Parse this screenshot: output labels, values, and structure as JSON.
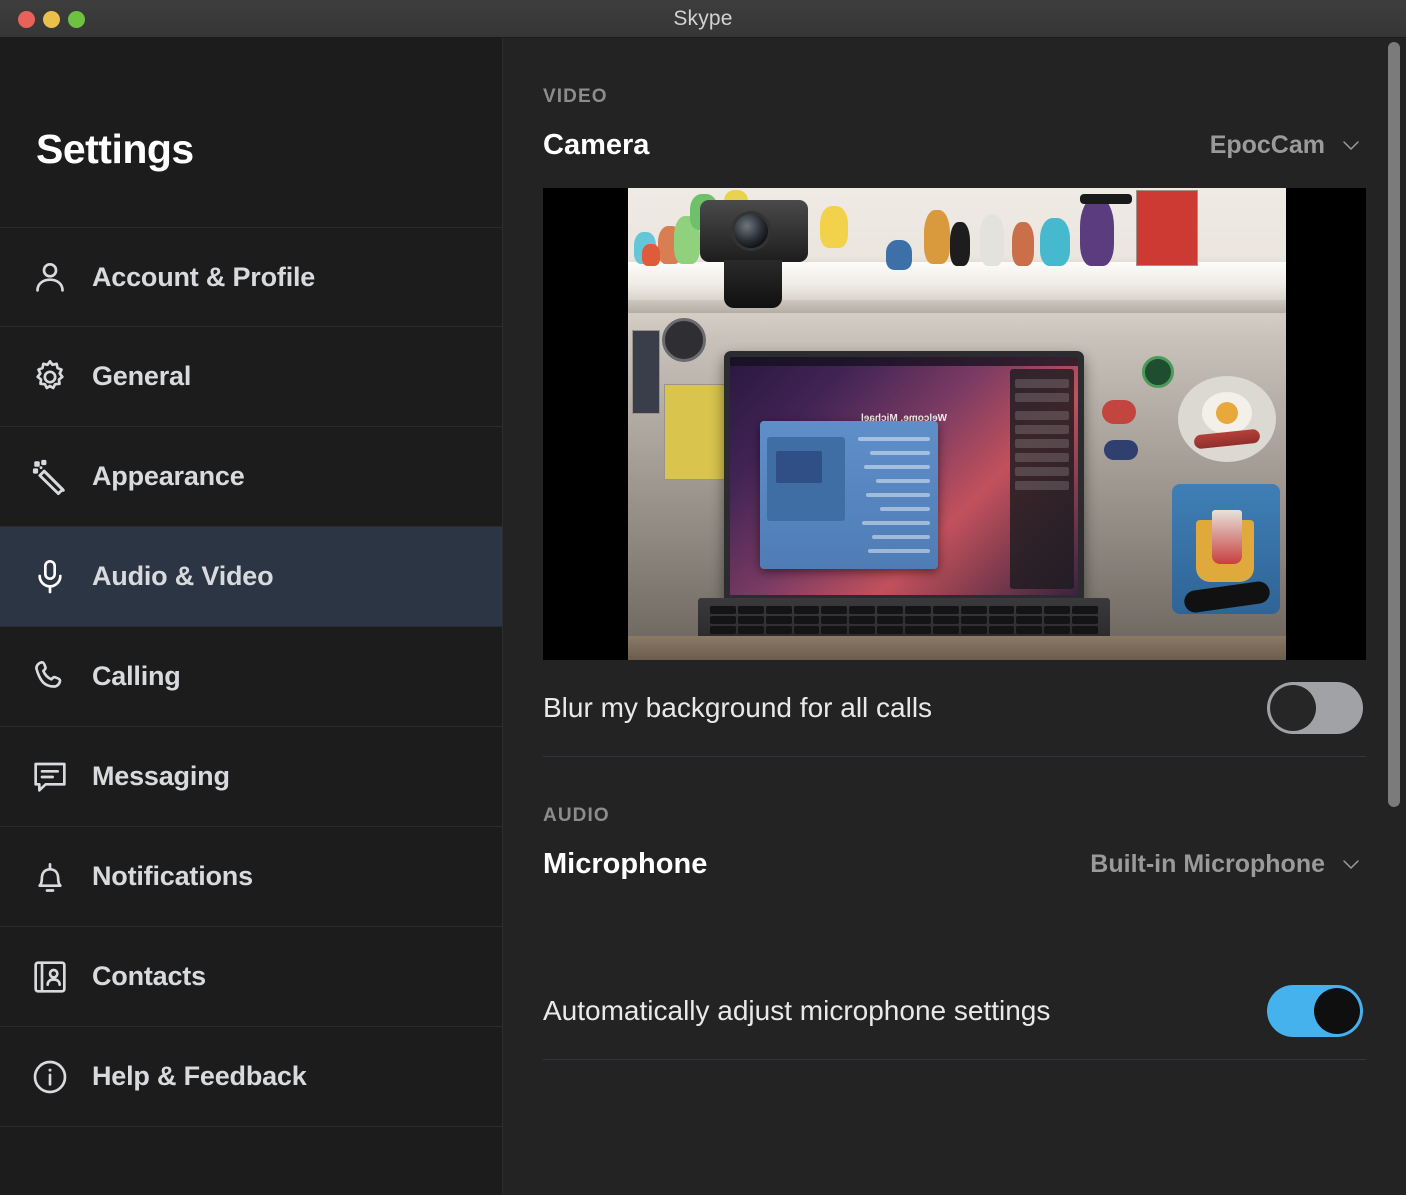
{
  "window": {
    "title": "Skype",
    "traffic_lights": [
      {
        "name": "close",
        "color": "#e8615b"
      },
      {
        "name": "minimize",
        "color": "#e9c04a"
      },
      {
        "name": "zoom",
        "color": "#6fc142"
      }
    ]
  },
  "sidebar": {
    "heading": "Settings",
    "items": [
      {
        "label": "Account & Profile",
        "icon": "person-icon",
        "active": false
      },
      {
        "label": "General",
        "icon": "gear-icon",
        "active": false
      },
      {
        "label": "Appearance",
        "icon": "magic-wand-icon",
        "active": false
      },
      {
        "label": "Audio & Video",
        "icon": "microphone-icon",
        "active": true
      },
      {
        "label": "Calling",
        "icon": "phone-icon",
        "active": false
      },
      {
        "label": "Messaging",
        "icon": "chat-bubble-icon",
        "active": false
      },
      {
        "label": "Notifications",
        "icon": "bell-icon",
        "active": false
      },
      {
        "label": "Contacts",
        "icon": "address-book-icon",
        "active": false
      },
      {
        "label": "Help & Feedback",
        "icon": "info-circle-icon",
        "active": false
      }
    ]
  },
  "content": {
    "video_section": {
      "label": "VIDEO",
      "camera": {
        "title": "Camera",
        "selected": "EpocCam",
        "chevron": "chevron-down-icon"
      },
      "preview": {
        "description": "Live webcam preview showing a desk with an open MacBook, a shelf of figurines, a Logitech webcam and wall stickers"
      },
      "blur": {
        "label": "Blur my background for all calls",
        "state": "off"
      }
    },
    "audio_section": {
      "label": "AUDIO",
      "microphone": {
        "title": "Microphone",
        "selected": "Built-in Microphone",
        "chevron": "chevron-down-icon"
      },
      "auto_adjust": {
        "label": "Automatically adjust microphone settings",
        "state": "on"
      }
    }
  },
  "colors": {
    "accent_on": "#45b2ed",
    "toggle_off": "#a0a2a6",
    "active_row": "#2b3543",
    "sidebar_bg": "#1c1c1c",
    "content_bg": "#232323"
  }
}
